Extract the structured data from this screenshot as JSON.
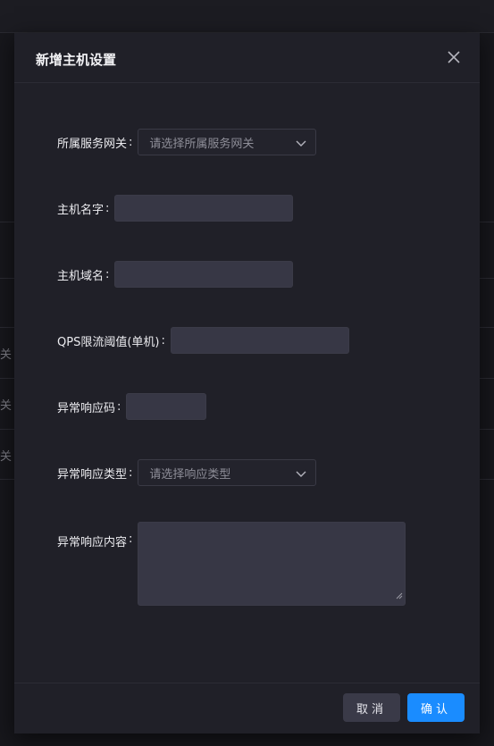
{
  "background": {
    "row_texts": [
      "关",
      "关",
      "关"
    ]
  },
  "dialog": {
    "title": "新增主机设置",
    "fields": {
      "gateway": {
        "label": "所属服务网关",
        "colon": ":",
        "placeholder": "请选择所属服务网关"
      },
      "host_name": {
        "label": "主机名字",
        "colon": ":",
        "value": ""
      },
      "host_domain": {
        "label": "主机域名",
        "colon": ":",
        "value": ""
      },
      "qps": {
        "label": "QPS限流阈值(单机)",
        "colon": ":",
        "value": ""
      },
      "error_code": {
        "label": "异常响应码",
        "colon": ":",
        "value": ""
      },
      "error_type": {
        "label": "异常响应类型",
        "colon": ":",
        "placeholder": "请选择响应类型"
      },
      "error_content": {
        "label": "异常响应内容",
        "colon": ":",
        "value": ""
      }
    },
    "footer": {
      "cancel_label": "取消",
      "ok_label": "确认"
    }
  },
  "colors": {
    "primary": "#1a8cff",
    "dialog_bg": "#202028",
    "input_bg": "#373745"
  },
  "icons": {
    "close": "close-icon",
    "chevron": "chevron-down-icon"
  }
}
